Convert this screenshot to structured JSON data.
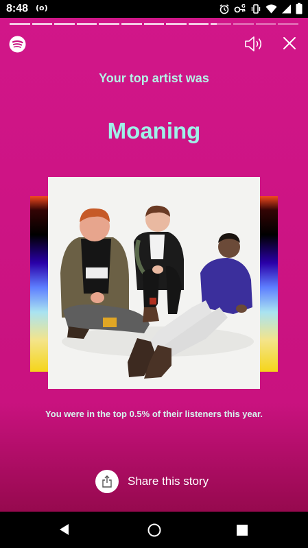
{
  "status_bar": {
    "time": "8:48",
    "notification": "(o)",
    "icons": [
      "alarm-icon",
      "vpn-key-icon",
      "vibrate-icon",
      "wifi-icon",
      "signal-icon",
      "battery-icon"
    ]
  },
  "story": {
    "progress": {
      "segments": 13,
      "completed": 9,
      "current_fill": 0.3
    },
    "colors": {
      "background": "#d11689",
      "title": "#9ff1e8"
    },
    "subtitle": "Your top artist was",
    "artist": "Moaning",
    "stat": "You were in the top 0.5% of their listeners this year.",
    "share_label": "Share this story",
    "icons": {
      "logo": "spotify-icon",
      "volume": "volume-icon",
      "close": "close-icon",
      "share": "share-icon"
    }
  },
  "nav_bar": {
    "icons": [
      "back-icon",
      "home-icon",
      "recents-icon"
    ]
  }
}
